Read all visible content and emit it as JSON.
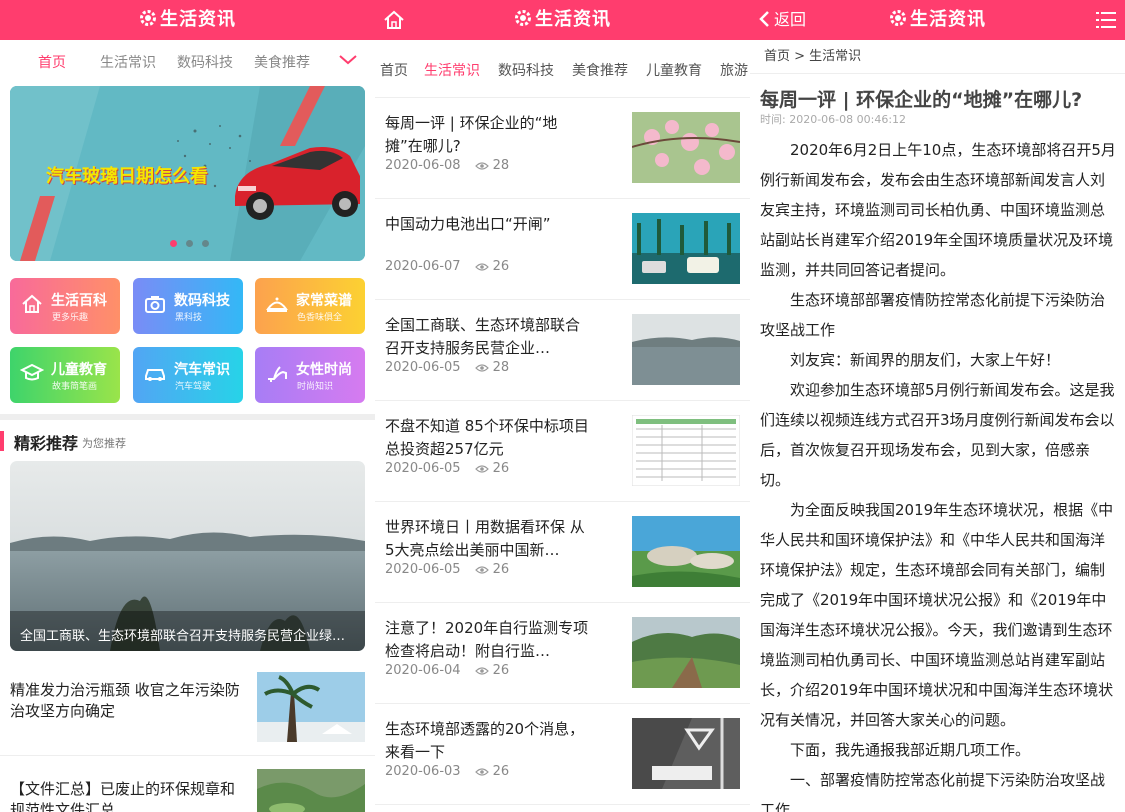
{
  "app": {
    "title": "生活资讯"
  },
  "panel1": {
    "tabs": [
      "首页",
      "生活常识",
      "数码科技",
      "美食推荐"
    ],
    "banner": {
      "text": "汽车玻璃日期怎么看",
      "dots": 3,
      "active_dot": 0
    },
    "categories": [
      {
        "name": "生活百科",
        "sub": "更多乐趣",
        "icon": "home-icon"
      },
      {
        "name": "数码科技",
        "sub": "黑科技",
        "icon": "camera-icon"
      },
      {
        "name": "家常菜谱",
        "sub": "色香味俱全",
        "icon": "dish-icon"
      },
      {
        "name": "儿童教育",
        "sub": "故事简笔画",
        "icon": "graduation-cap-icon"
      },
      {
        "name": "汽车常识",
        "sub": "汽车驾驶",
        "icon": "car-icon"
      },
      {
        "name": "女性时尚",
        "sub": "时尚知识",
        "icon": "high-heel-icon"
      }
    ],
    "section": {
      "title": "精彩推荐",
      "subtitle": "为您推荐"
    },
    "feature": {
      "caption": "全国工商联、生态环境部联合召开支持服务民营企业绿色发展..."
    },
    "list": [
      {
        "title": "精准发力治污瓶颈 收官之年污染防治攻坚方向确定"
      },
      {
        "title": "【文件汇总】已废止的环保规章和规范性文件汇总"
      }
    ]
  },
  "panel2": {
    "tabs": [
      "首页",
      "生活常识",
      "数码科技",
      "美食推荐",
      "儿童教育",
      "旅游"
    ],
    "articles": [
      {
        "title": "每周一评 | 环保企业的“地摊”在哪儿?",
        "date": "2020-06-08",
        "views": "28"
      },
      {
        "title": "中国动力电池出口“开闸”",
        "date": "2020-06-07",
        "views": "26"
      },
      {
        "title": "全国工商联、生态环境部联合召开支持服务民营企业…",
        "date": "2020-06-05",
        "views": "28"
      },
      {
        "title": "不盘不知道 85个环保中标项目总投资超257亿元",
        "date": "2020-06-05",
        "views": "26"
      },
      {
        "title": "世界环境日丨用数据看环保 从5大亮点绘出美丽中国新…",
        "date": "2020-06-05",
        "views": "26"
      },
      {
        "title": "注意了！2020年自行监测专项检查将启动！附自行监…",
        "date": "2020-06-04",
        "views": "26"
      },
      {
        "title": "生态环境部透露的20个消息，来看一下",
        "date": "2020-06-03",
        "views": "26"
      }
    ]
  },
  "panel3": {
    "back_label": "返回",
    "breadcrumb": "首页 > 生活常识",
    "title": "每周一评 | 环保企业的“地摊”在哪儿?",
    "time": "时间: 2020-06-08 00:46:12",
    "paragraphs": [
      "2020年6月2日上午10点，生态环境部将召开5月例行新闻发布会，发布会由生态环境部新闻发言人刘友宾主持，环境监测司司长柏仇勇、中国环境监测总站副站长肖建军介绍2019年全国环境质量状况及环境监测，并共同回答记者提问。",
      "生态环境部部署疫情防控常态化前提下污染防治攻坚战工作",
      "刘友宾：新闻界的朋友们，大家上午好！",
      "欢迎参加生态环境部5月例行新闻发布会。这是我们连续以视频连线方式召开3场月度例行新闻发布会以后，首次恢复召开现场发布会，见到大家，倍感亲切。",
      "为全面反映我国2019年生态环境状况，根据《中华人民共和国环境保护法》和《中华人民共和国海洋环境保护法》规定，生态环境部会同有关部门，编制完成了《2019年中国环境状况公报》和《2019年中国海洋生态环境状况公报》。今天，我们邀请到生态环境监测司柏仇勇司长、中国环境监测总站肖建军副站长，介绍2019年中国环境状况和中国海洋生态环境状况有关情况，并回答大家关心的问题。",
      "下面，我先通报我部近期几项工作。",
      "一、部署疫情防控常态化前提下污染防治攻坚战工作"
    ]
  },
  "colors": {
    "brand": "#ff3d6e"
  }
}
